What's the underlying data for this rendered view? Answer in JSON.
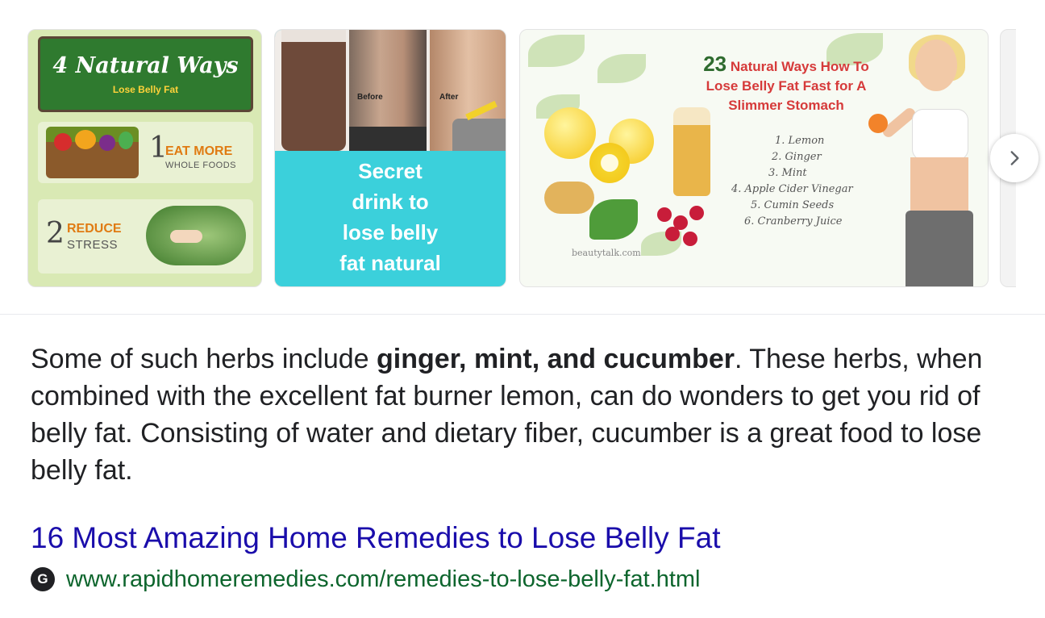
{
  "carousel": {
    "tiles": [
      {
        "banner_title": "4 Natural Ways",
        "banner_subtitle": "Lose Belly Fat",
        "item1_num": "1",
        "item1_title": "EAT MORE",
        "item1_sub": "WHOLE FOODS",
        "item2_num": "2",
        "item2_title": "REDUCE",
        "item2_sub": "STRESS"
      },
      {
        "before_label": "Before",
        "after_label": "After",
        "caption_lines": [
          "Secret",
          "drink to",
          "lose belly",
          "fat natural"
        ]
      },
      {
        "title_num": "23",
        "title_rest": "Natural Ways How To",
        "title_line2": "Lose Belly Fat Fast for A",
        "title_line3": "Slimmer Stomach",
        "list": [
          "1. Lemon",
          "2. Ginger",
          "3. Mint",
          "4. Apple Cider Vinegar",
          "5. Cumin Seeds",
          "6. Cranberry Juice"
        ],
        "watermark": "beautytalk.com"
      }
    ],
    "next_icon": "chevron-right-icon"
  },
  "snippet": {
    "lead": "Some of such herbs include ",
    "bold": "ginger, mint, and cucumber",
    "rest": ". These herbs, when combined with the excellent fat burner lemon, can do wonders to get you rid of belly fat. Consisting of water and dietary fiber, cucumber is a great food to lose belly fat."
  },
  "result": {
    "title": "16 Most Amazing Home Remedies to Lose Belly Fat",
    "favicon_letter": "G",
    "url": "www.rapidhomeremedies.com/remedies-to-lose-belly-fat.html"
  },
  "colors": {
    "link": "#1a0dab",
    "url": "#0d652d",
    "text": "#202124"
  }
}
